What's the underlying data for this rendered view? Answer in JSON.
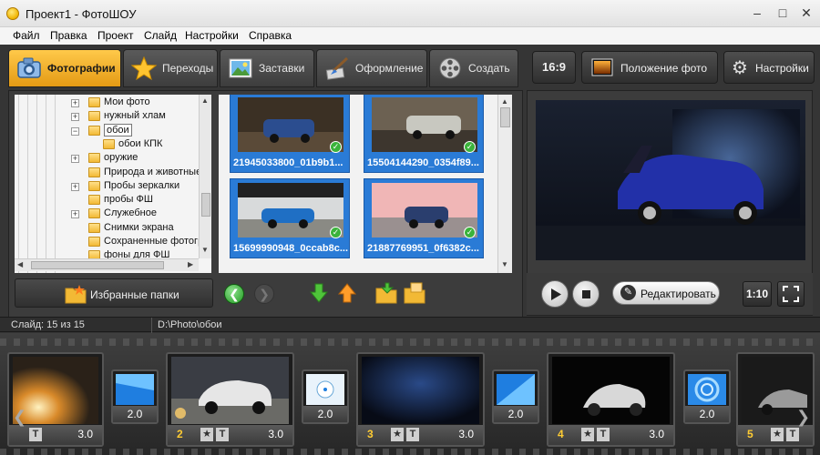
{
  "window": {
    "title": "Проект1 - ФотоШОУ"
  },
  "menu": [
    "Файл",
    "Правка",
    "Проект",
    "Слайд",
    "Настройки",
    "Справка"
  ],
  "tabs": [
    {
      "label": "Фотографии",
      "icon": "camera-icon",
      "active": true
    },
    {
      "label": "Переходы",
      "icon": "star-icon"
    },
    {
      "label": "Заставки",
      "icon": "landscape-icon"
    },
    {
      "label": "Оформление",
      "icon": "brush-icon"
    },
    {
      "label": "Создать",
      "icon": "film-reel-icon"
    }
  ],
  "right_toolbar": {
    "aspect": "16:9",
    "photo_position": "Положение фото",
    "settings": "Настройки"
  },
  "tree": [
    {
      "label": "Мои фото",
      "expander": "+",
      "level": 0
    },
    {
      "label": "нужный хлам",
      "expander": "+",
      "level": 0
    },
    {
      "label": "обои",
      "expander": "−",
      "level": 0,
      "selected": true
    },
    {
      "label": "обои КПК",
      "expander": "",
      "level": 1
    },
    {
      "label": "оружие",
      "expander": "+",
      "level": 0
    },
    {
      "label": "Природа и животные",
      "expander": "",
      "level": 0
    },
    {
      "label": "Пробы зеркалки",
      "expander": "+",
      "level": 0
    },
    {
      "label": "пробы ФШ",
      "expander": "",
      "level": 0
    },
    {
      "label": "Служебное",
      "expander": "+",
      "level": 0
    },
    {
      "label": "Снимки экрана",
      "expander": "",
      "level": 0
    },
    {
      "label": "Сохраненные фотогр",
      "expander": "",
      "level": 0
    },
    {
      "label": "фоны для ФШ",
      "expander": "",
      "level": 0
    }
  ],
  "thumbnails": [
    {
      "caption": "21945033800_01b9b1..."
    },
    {
      "caption": "15504144290_0354f89..."
    },
    {
      "caption": "15699990948_0ccab8c..."
    },
    {
      "caption": "21887769951_0f6382c..."
    }
  ],
  "favorites_button": "Избранные папки",
  "preview": {
    "edit_label": "Редактировать",
    "ratio_label": "1:10"
  },
  "status": {
    "slide": "Слайд: 15 из 15",
    "path": "D:\\Photo\\обои"
  },
  "timeline": {
    "slides": [
      {
        "num": "",
        "duration": "3.0"
      },
      {
        "num": "2",
        "duration": "3.0"
      },
      {
        "num": "3",
        "duration": "3.0"
      },
      {
        "num": "4",
        "duration": "3.0"
      },
      {
        "num": "5",
        "duration": "3.0"
      }
    ],
    "transitions": [
      {
        "duration": "2.0"
      },
      {
        "duration": "2.0"
      },
      {
        "duration": "2.0"
      },
      {
        "duration": "2.0"
      }
    ]
  }
}
